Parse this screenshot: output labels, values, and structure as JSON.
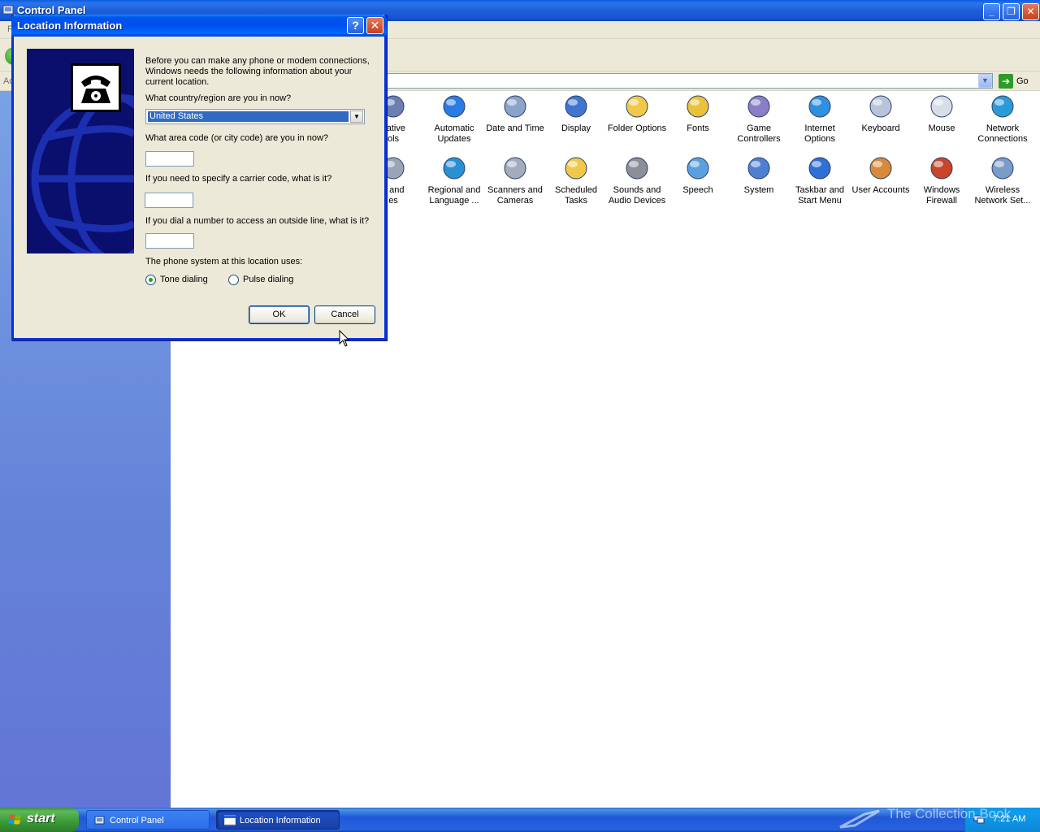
{
  "window": {
    "title": "Control Panel",
    "menu_hint": "F",
    "address_label": "Ad",
    "go_label": "Go"
  },
  "control_panel_icons": [
    {
      "label": "trative\nols",
      "icon": "admin-tools-icon"
    },
    {
      "label": "Automatic\nUpdates",
      "icon": "automatic-updates-icon"
    },
    {
      "label": "Date and Time",
      "icon": "date-time-icon"
    },
    {
      "label": "Display",
      "icon": "display-icon"
    },
    {
      "label": "Folder Options",
      "icon": "folder-options-icon"
    },
    {
      "label": "Fonts",
      "icon": "fonts-icon"
    },
    {
      "label": "Game\nControllers",
      "icon": "game-controllers-icon"
    },
    {
      "label": "Internet\nOptions",
      "icon": "internet-options-icon"
    },
    {
      "label": "Keyboard",
      "icon": "keyboard-icon"
    },
    {
      "label": "Mouse",
      "icon": "mouse-icon"
    },
    {
      "label": "Network\nConnections",
      "icon": "network-connections-icon"
    },
    {
      "label": "s and\nes",
      "icon": "printers-faxes-icon"
    },
    {
      "label": "Regional and\nLanguage ...",
      "icon": "regional-language-icon"
    },
    {
      "label": "Scanners and\nCameras",
      "icon": "scanners-cameras-icon"
    },
    {
      "label": "Scheduled\nTasks",
      "icon": "scheduled-tasks-icon"
    },
    {
      "label": "Sounds and\nAudio Devices",
      "icon": "sounds-audio-icon"
    },
    {
      "label": "Speech",
      "icon": "speech-icon"
    },
    {
      "label": "System",
      "icon": "system-icon"
    },
    {
      "label": "Taskbar and\nStart Menu",
      "icon": "taskbar-start-menu-icon"
    },
    {
      "label": "User Accounts",
      "icon": "user-accounts-icon"
    },
    {
      "label": "Windows\nFirewall",
      "icon": "windows-firewall-icon"
    },
    {
      "label": "Wireless\nNetwork Set...",
      "icon": "wireless-network-icon"
    }
  ],
  "dialog": {
    "title": "Location Information",
    "help_button": "?",
    "close_button": "✕",
    "intro": "Before you can make any phone or modem connections, Windows needs the following information about your current location.",
    "country_question": "What country/region are you in now?",
    "country_value": "United States",
    "area_code_question": "What area code (or city code) are you in now?",
    "area_code_value": "",
    "carrier_question": "If you need to specify a carrier code, what is it?",
    "carrier_value": "",
    "outside_line_question": "If you dial a number to access an outside line, what is it?",
    "outside_line_value": "",
    "phone_system_question": "The phone system at this location uses:",
    "tone_label": "Tone dialing",
    "pulse_label": "Pulse dialing",
    "selected_dialing": "tone",
    "ok_label": "OK",
    "cancel_label": "Cancel"
  },
  "taskbar": {
    "start_label": "start",
    "tasks": [
      {
        "label": "Control Panel",
        "active": false
      },
      {
        "label": "Location Information",
        "active": true
      }
    ],
    "clock": "7:21 AM",
    "watermark": "The Collection Book"
  },
  "colors": {
    "titlebar_blue": "#0053ee",
    "sidebar_blue": "#6483d8",
    "dialog_face": "#ece9d8",
    "selection_blue": "#316ac5",
    "start_green": "#3a9a36"
  }
}
